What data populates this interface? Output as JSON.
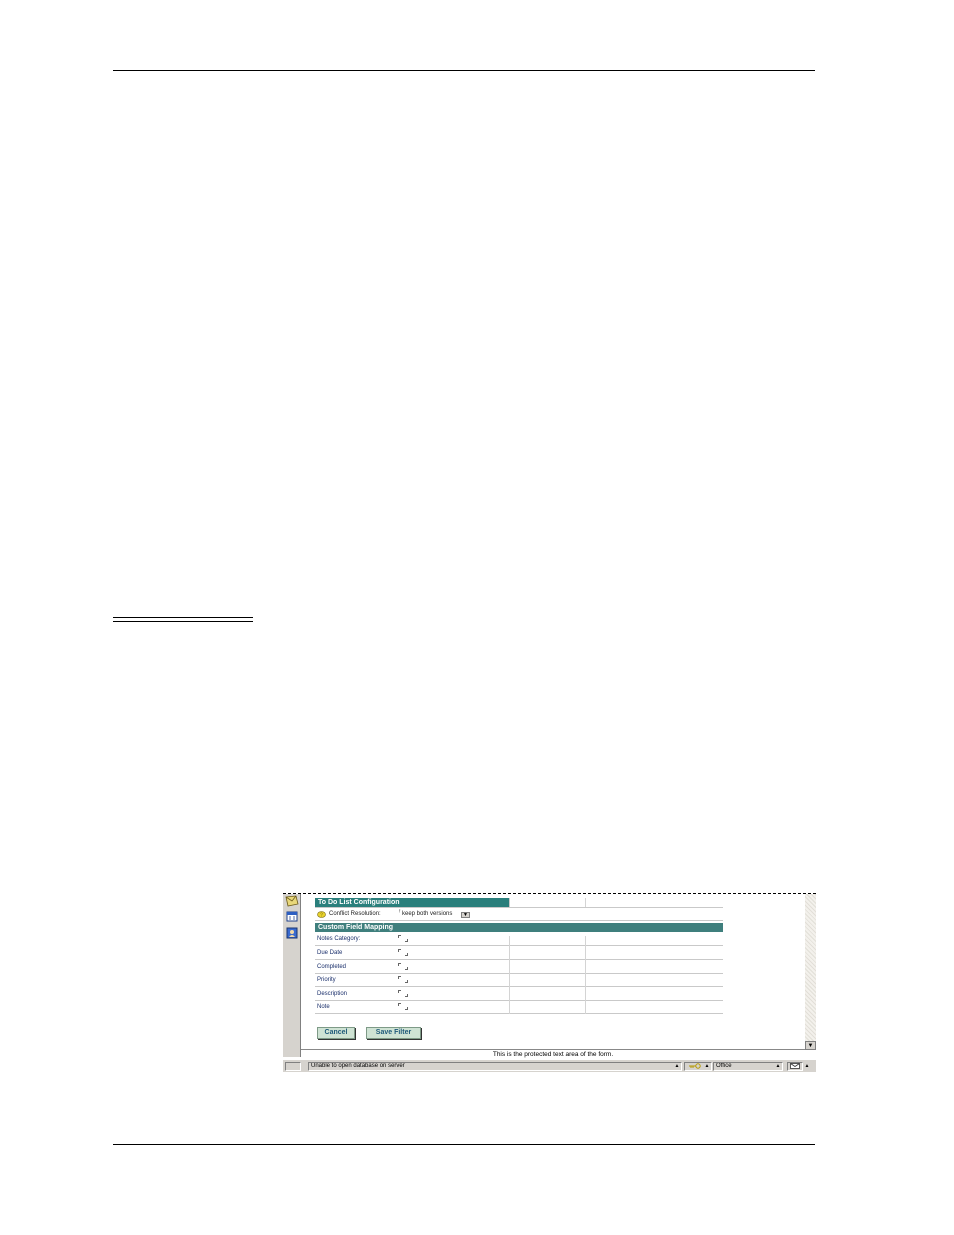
{
  "form": {
    "todo_header": "To Do List Configuration",
    "conflict_label": "Conflict Resolution:",
    "conflict_value": "keep both versions",
    "custom_header": "Custom Field Mapping",
    "fields": [
      {
        "label": "Notes Category:"
      },
      {
        "label": "Due Date"
      },
      {
        "label": "Completed"
      },
      {
        "label": "Priority"
      },
      {
        "label": "Description"
      },
      {
        "label": "Note"
      }
    ],
    "cancel_label": "Cancel",
    "save_label": "Save Filter",
    "protected_text": "This is the protected text area of the form."
  },
  "status_bar": {
    "message": "Unable to open database  on server",
    "location": "Office"
  },
  "icons": {
    "nav": [
      "mail-icon",
      "calendar-icon",
      "address-book-icon"
    ],
    "conflict": "conflict-icon",
    "status_lock": "key-icon",
    "status_inbox": "inbox-icon"
  },
  "colors": {
    "header": "#2a7f7c",
    "button": "#cfe3d4",
    "label": "#1a2f6b"
  }
}
